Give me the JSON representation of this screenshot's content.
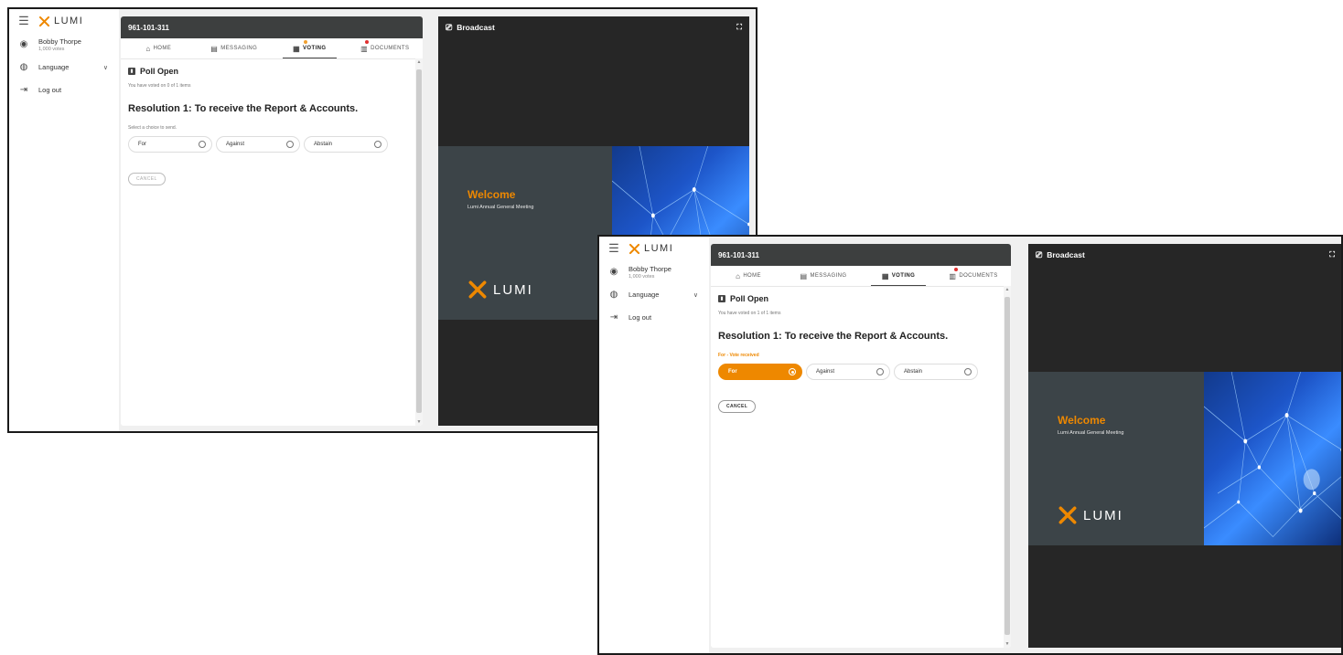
{
  "app": {
    "logo_text": "LUMI",
    "meeting_id": "961-101-311"
  },
  "colors": {
    "accent": "#ee8800",
    "header_bg": "#3d3f3f",
    "broadcast_bg": "#262626"
  },
  "sidebar": {
    "user_name": "Bobby Thorpe",
    "user_votes": "1,000 votes",
    "language_label": "Language",
    "logout_label": "Log out"
  },
  "tabs": [
    {
      "label": "HOME",
      "icon": "home-icon"
    },
    {
      "label": "MESSAGING",
      "icon": "messaging-icon"
    },
    {
      "label": "VOTING",
      "icon": "voting-icon"
    },
    {
      "label": "DOCUMENTS",
      "icon": "documents-icon"
    }
  ],
  "poll": {
    "title": "Poll Open",
    "resolution": "Resolution 1: To receive the Report & Accounts.",
    "options": [
      "For",
      "Against",
      "Abstain"
    ],
    "cancel_label": "CANCEL"
  },
  "screen1": {
    "voted_status": "You have voted on 0 of 1 items",
    "instruction": "Select a choice to send."
  },
  "screen2": {
    "voted_status": "You have voted on 1 of 1 items",
    "vote_received": "For - Vote received",
    "selected_option": "For"
  },
  "broadcast": {
    "title": "Broadcast",
    "welcome": "Welcome",
    "meeting_name": "Lumi Annual General Meeting",
    "logo_text": "LUMI"
  }
}
